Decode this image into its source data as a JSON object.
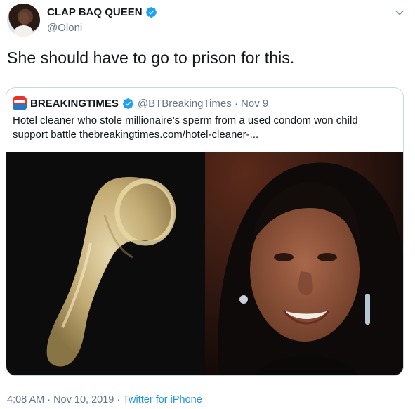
{
  "tweet": {
    "display_name": "CLAP BAQ QUEEN",
    "handle": "@Oloni",
    "text": "She should have to go to prison for this.",
    "timestamp": "4:08 AM · Nov 10, 2019 · ",
    "client": "Twitter for iPhone"
  },
  "quoted": {
    "display_name": "BREAKINGTIMES",
    "handle_and_date": "@BTBreakingTimes · Nov 9",
    "text": "Hotel cleaner who stole millionaire’s sperm from a used condom won child support battle thebreakingtimes.com/hotel-cleaner-..."
  },
  "icons": {
    "verified": "verified-badge-icon",
    "caret": "chevron-down-icon"
  },
  "colors": {
    "verified_blue": "#1da1f2",
    "link_blue": "#1b95e0",
    "muted": "#657786"
  }
}
